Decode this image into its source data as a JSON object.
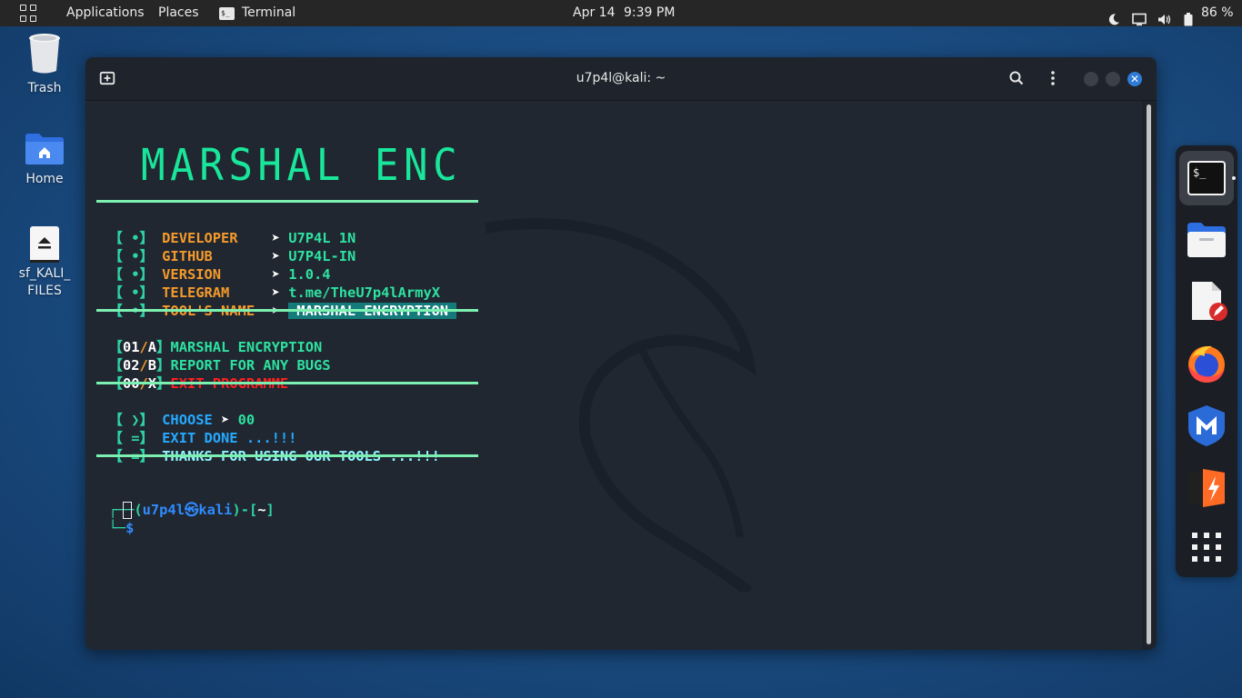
{
  "top_panel": {
    "applications_label": "Applications",
    "places_label": "Places",
    "terminal_label": "Terminal",
    "date": "Apr 14",
    "time": "9:39 PM",
    "battery_percent": "86 %",
    "icons": [
      "apps-grid-icon",
      "night-mode-icon",
      "display-icon",
      "volume-icon",
      "battery-icon"
    ]
  },
  "desktop": {
    "icons": [
      {
        "label": "Trash",
        "icon": "trash-icon"
      },
      {
        "label": "Home",
        "icon": "home-folder-icon"
      },
      {
        "label": "sf_KALI_\nFILES",
        "icon": "drive-icon"
      }
    ]
  },
  "window": {
    "title": "u7p4l@kali: ~"
  },
  "terminal": {
    "banner": "MARSHAL ENC",
    "info": [
      {
        "bullet": "【 •】",
        "key": "DEVELOPER    ",
        "arrow": "➤",
        "value": "U7P4L 1N"
      },
      {
        "bullet": "【 •】",
        "key": "GITHUB       ",
        "arrow": "➤",
        "value": "U7P4L-IN"
      },
      {
        "bullet": "【 •】",
        "key": "VERSION      ",
        "arrow": "➤",
        "value": "1.0.4"
      },
      {
        "bullet": "【 •】",
        "key": "TELEGRAM     ",
        "arrow": "➤",
        "value": "t.me/TheU7p4lArmyX"
      },
      {
        "bullet": "【 •】",
        "key": "TOOL'S NAME  ",
        "arrow": "➤",
        "value": "MARSHAL ENCRYPTION"
      }
    ],
    "menu": [
      {
        "code": "01",
        "slash": "/",
        "letter": "A",
        "label": "MARSHAL ENCRYPTION"
      },
      {
        "code": "02",
        "slash": "/",
        "letter": "B",
        "label": "REPORT FOR ANY BUGS"
      },
      {
        "code": "00",
        "slash": "/",
        "letter": "X",
        "label": "EXIT PROGRAMME"
      }
    ],
    "choose_label": "CHOOSE",
    "choose_arrow": "➤",
    "choose_value": "00",
    "choose_bracket": "【 ❯】",
    "exit_bracket": "【 =】",
    "exit_msg": "EXIT DONE ...!!!",
    "thanks_bracket": "【 =】",
    "thanks_msg": "THANKS FOR USING OUR TOOLS ...!!!",
    "prompt_open": "┌──(",
    "prompt_user": "u7p4l",
    "prompt_sym": "㉿",
    "prompt_host": "kali",
    "prompt_close": ")-[",
    "prompt_dir": "~",
    "prompt_end": "]",
    "prompt_line2": "└─",
    "prompt_dollar": "$"
  },
  "dock": {
    "items": [
      "terminal-icon",
      "files-icon",
      "text-editor-icon",
      "firefox-icon",
      "metasploit-icon",
      "burpsuite-icon",
      "show-apps-icon"
    ]
  },
  "colors": {
    "accent": "#2f7bd6",
    "banner": "#19e69a",
    "orange": "#f59a2b",
    "red": "#ff1f1f"
  }
}
